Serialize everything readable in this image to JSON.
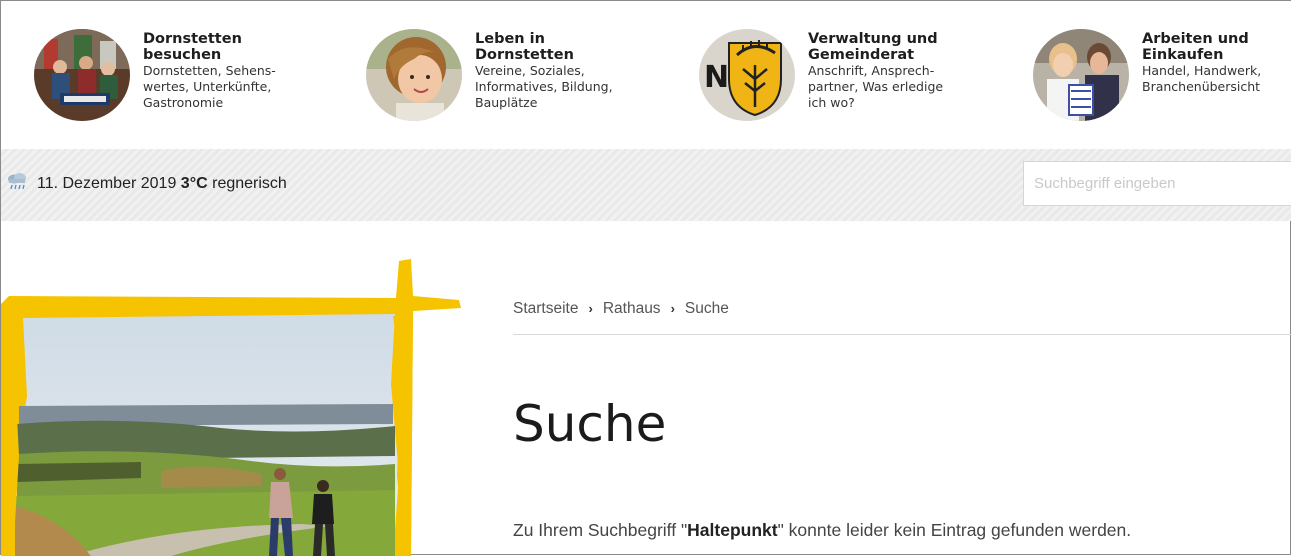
{
  "nav": {
    "items": [
      {
        "title_line1": "Dornstetten",
        "title_line2": "besuchen",
        "desc_lines": [
          "Dornstetten, Sehens-",
          "wertes, Unterkünfte,",
          "Gastronomie"
        ],
        "image": "town-festival-photo"
      },
      {
        "title_line1": "Leben in",
        "title_line2": "Dornstetten",
        "desc_lines": [
          "Vereine, Soziales,",
          "Informatives, Bildung,",
          "Bauplätze"
        ],
        "image": "girl-portrait-photo"
      },
      {
        "title_line1": "Verwaltung und",
        "title_line2": "Gemeinderat",
        "desc_lines": [
          "Anschrift, Ansprech-",
          "partner, Was erledige",
          "ich wo?"
        ],
        "image": "coat-of-arms-photo"
      },
      {
        "title_line1": "Arbeiten und",
        "title_line2": "Einkaufen",
        "desc_lines": [
          "Handel, Handwerk,",
          "Branchenübersicht"
        ],
        "image": "shoppers-photo"
      }
    ]
  },
  "infobar": {
    "weather_icon": "rain-cloud-icon",
    "date": "11. Dezember 2019",
    "temperature": "3°C",
    "condition": "regnerisch"
  },
  "search": {
    "placeholder": "Suchbegriff eingeben",
    "value": ""
  },
  "breadcrumb": {
    "items": [
      "Startseite",
      "Rathaus",
      "Suche"
    ],
    "separator": "›"
  },
  "page": {
    "title": "Suche",
    "message_prefix": "Zu Ihrem Suchbegriff \"",
    "search_term": "Haltepunkt",
    "message_suffix": "\" konnte leider kein Eintrag gefunden werden."
  },
  "colors": {
    "frame_yellow": "#f5c300",
    "stripe_light": "#f1f1f1",
    "stripe_dark": "#e9e9e9"
  }
}
